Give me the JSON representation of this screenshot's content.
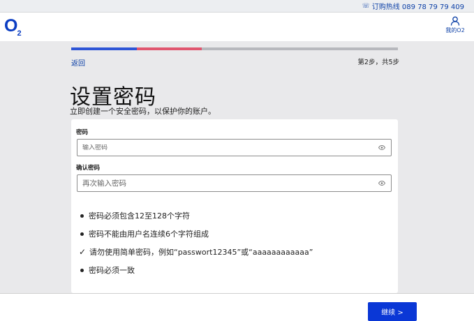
{
  "topbar": {
    "phone_icon": "phone-icon",
    "hotline": "订购热线 089 78 79 79 409"
  },
  "header": {
    "logo": {
      "main": "O",
      "sub": "2"
    },
    "account": {
      "icon": "user-icon",
      "label": "我的O2"
    }
  },
  "progress": {
    "total_steps": 5,
    "segments": [
      {
        "color": "#2e55d6",
        "fraction": 0.2
      },
      {
        "color": "#e0566f",
        "fraction": 0.2
      }
    ],
    "track_color": "#b7b8bd"
  },
  "nav": {
    "back": "返回",
    "step": "第2步，共5步"
  },
  "page": {
    "title": "设置密码",
    "subtitle": "立即创建一个安全密码，以保护你的账户。"
  },
  "form": {
    "password": {
      "label": "密码",
      "placeholder": "输入密码",
      "value": "",
      "icon": "eye-icon"
    },
    "confirm": {
      "label": "确认密码",
      "placeholder": "再次输入密码",
      "value": "",
      "icon": "eye-icon"
    }
  },
  "requirements": [
    {
      "text": "密码必须包含12至128个字符",
      "status": "bullet"
    },
    {
      "text": "密码不能由用户名连续6个字符组成",
      "status": "bullet"
    },
    {
      "text": "请勿使用简单密码，例如“passwort12345”或“aaaaaaaaaaaa”",
      "status": "check"
    },
    {
      "text": "密码必须一致",
      "status": "bullet"
    }
  ],
  "footer": {
    "continue": "继续 >"
  },
  "colors": {
    "brand": "#0a3cc2",
    "button": "#0a37d6",
    "link": "#0b3fa6"
  }
}
